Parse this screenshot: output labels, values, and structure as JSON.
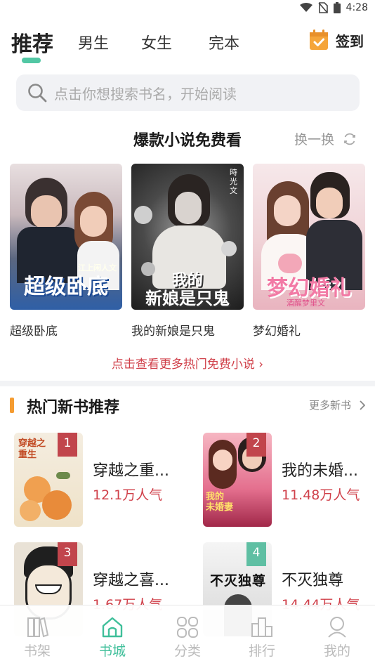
{
  "status_bar": {
    "time": "4:28"
  },
  "tabs": [
    {
      "label": "推荐"
    },
    {
      "label": "男生"
    },
    {
      "label": "女生"
    },
    {
      "label": "完本"
    }
  ],
  "signin": {
    "label": "签到"
  },
  "search": {
    "placeholder": "点击你想搜索书名，开始阅读"
  },
  "featured": {
    "title": "爆款小说免费看",
    "refresh_label": "换一换",
    "books": [
      {
        "title": "超级卧底",
        "cover_text": "超级卧底",
        "cover_small": "江上闲人文"
      },
      {
        "title": "我的新娘是只鬼",
        "cover_text_1": "我的",
        "cover_text_2": "新娘是只鬼",
        "cover_small": "時光文"
      },
      {
        "title": "梦幻婚礼",
        "cover_text": "梦幻婚礼",
        "cover_small": "酒醒梦里文"
      }
    ],
    "more_label": "点击查看更多热门免费小说"
  },
  "hot_new": {
    "title": "热门新书推荐",
    "more_label": "更多新书",
    "books": [
      {
        "rank": "1",
        "name": "穿越之重...",
        "popularity": "12.1万人气"
      },
      {
        "rank": "2",
        "name": "我的未婚...",
        "popularity": "11.48万人气"
      },
      {
        "rank": "3",
        "name": "穿越之喜...",
        "popularity": "1.67万人气"
      },
      {
        "rank": "4",
        "name": "不灭独尊",
        "popularity": "14.44万人气"
      }
    ]
  },
  "bottom_nav": [
    {
      "label": "书架"
    },
    {
      "label": "书城"
    },
    {
      "label": "分类"
    },
    {
      "label": "排行"
    },
    {
      "label": "我的"
    }
  ],
  "colors": {
    "accent": "#3fbf9a",
    "hot_red": "#d0404a",
    "orange": "#f59c31"
  }
}
